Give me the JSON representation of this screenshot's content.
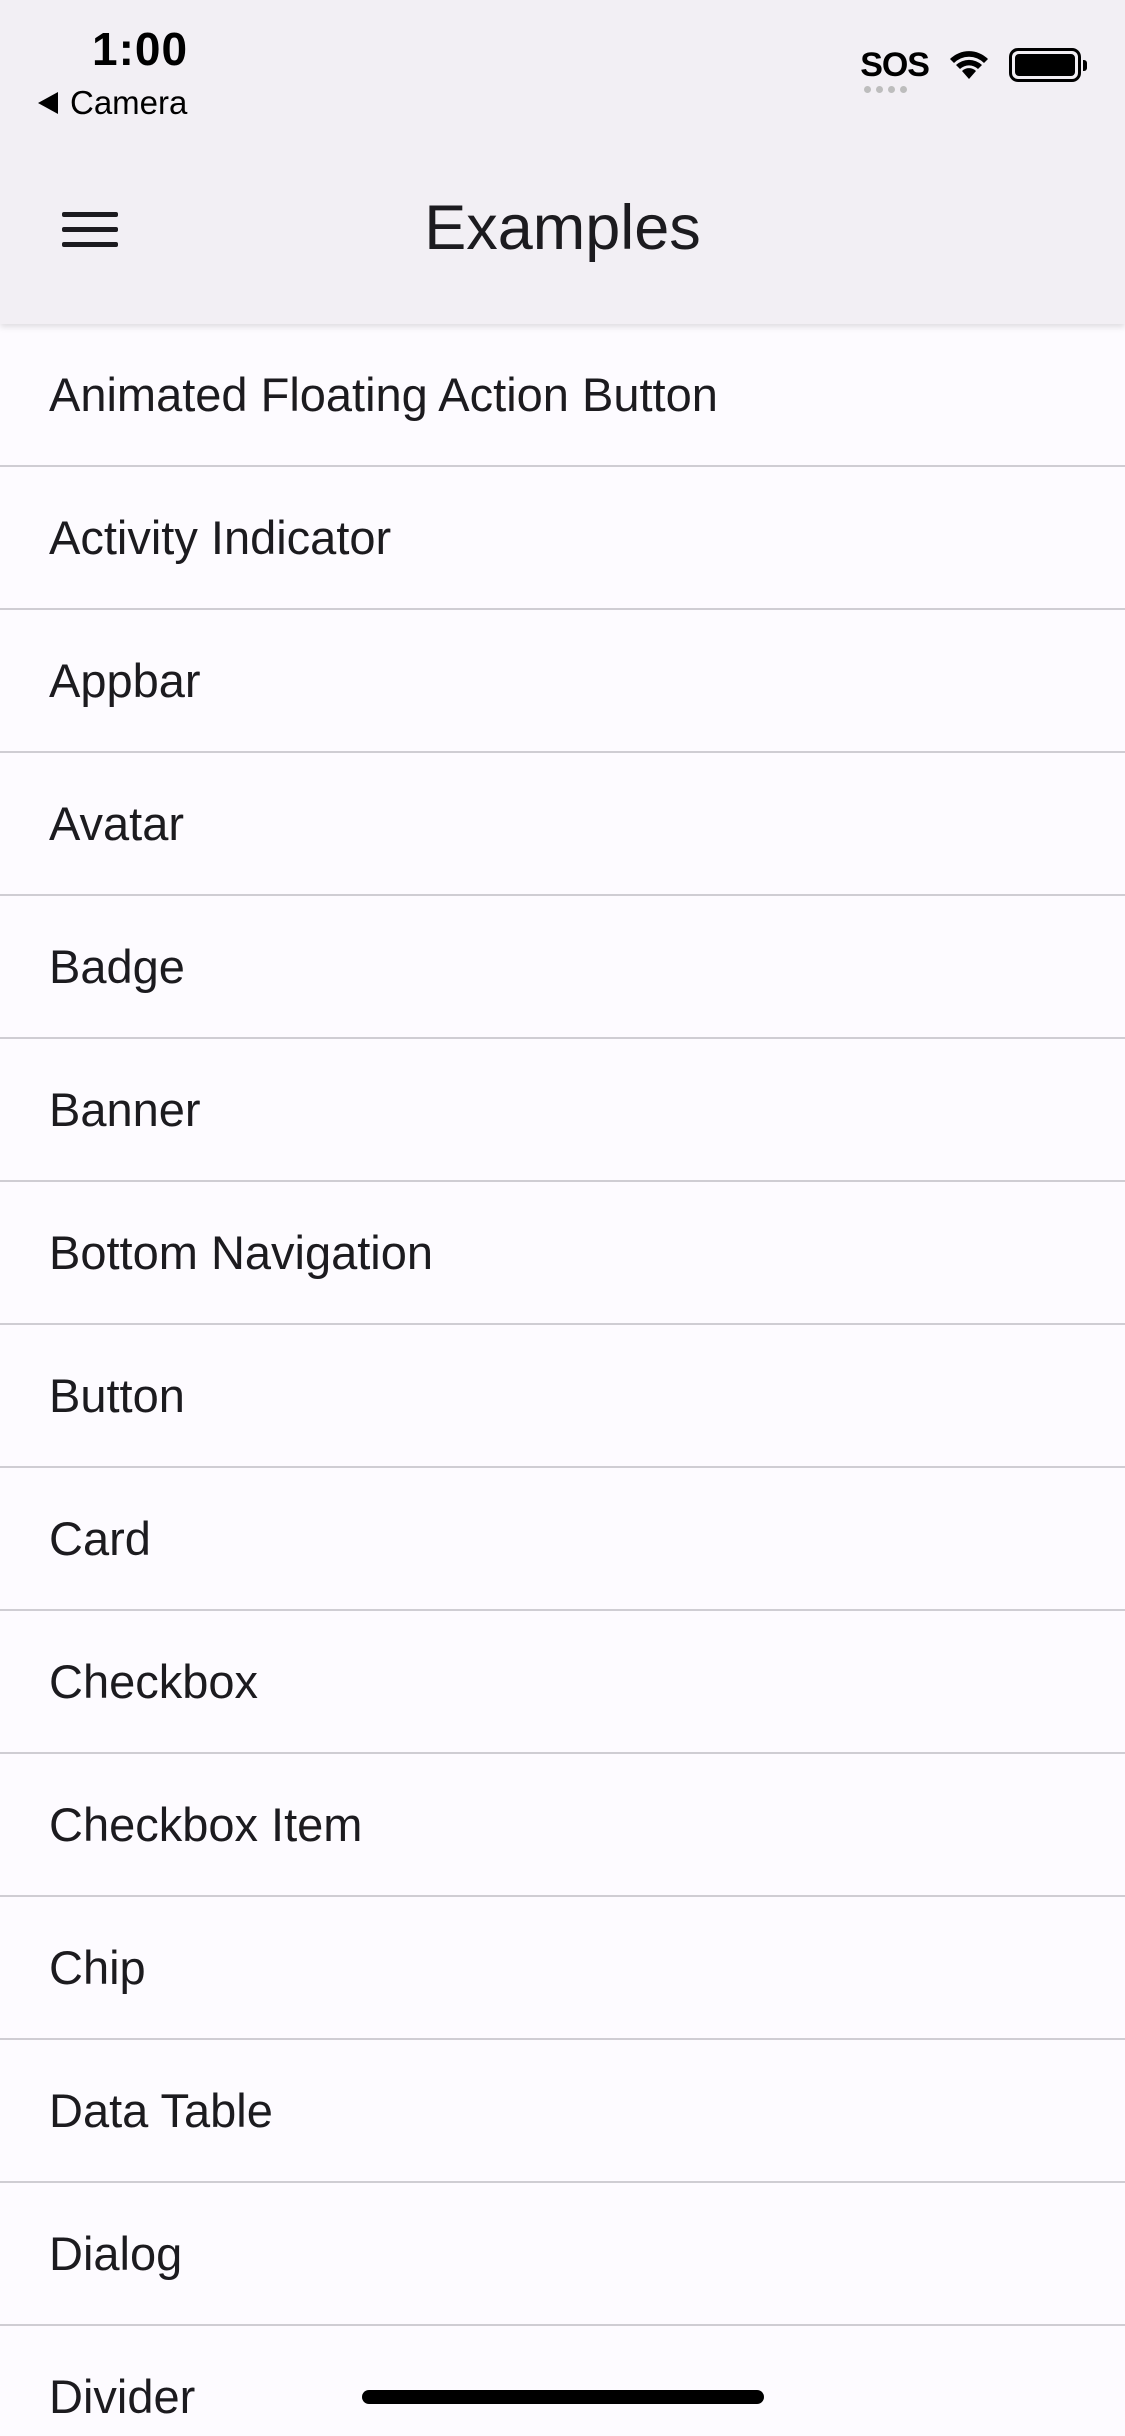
{
  "status_bar": {
    "time": "1:00",
    "back_label": "Camera",
    "sos": "SOS",
    "icons": [
      "wifi-icon",
      "battery-icon"
    ]
  },
  "app_bar": {
    "title": "Examples",
    "menu_icon": "hamburger-menu-icon"
  },
  "list": {
    "items": [
      {
        "label": "Animated Floating Action Button"
      },
      {
        "label": "Activity Indicator"
      },
      {
        "label": "Appbar"
      },
      {
        "label": "Avatar"
      },
      {
        "label": "Badge"
      },
      {
        "label": "Banner"
      },
      {
        "label": "Bottom Navigation"
      },
      {
        "label": "Button"
      },
      {
        "label": "Card"
      },
      {
        "label": "Checkbox"
      },
      {
        "label": "Checkbox Item"
      },
      {
        "label": "Chip"
      },
      {
        "label": "Data Table"
      },
      {
        "label": "Dialog"
      },
      {
        "label": "Divider"
      }
    ]
  },
  "colors": {
    "app_bar_bg": "#f2eff4",
    "list_bg": "#fdfbff",
    "divider": "#cfcdd3",
    "text": "#1c1b1f"
  }
}
